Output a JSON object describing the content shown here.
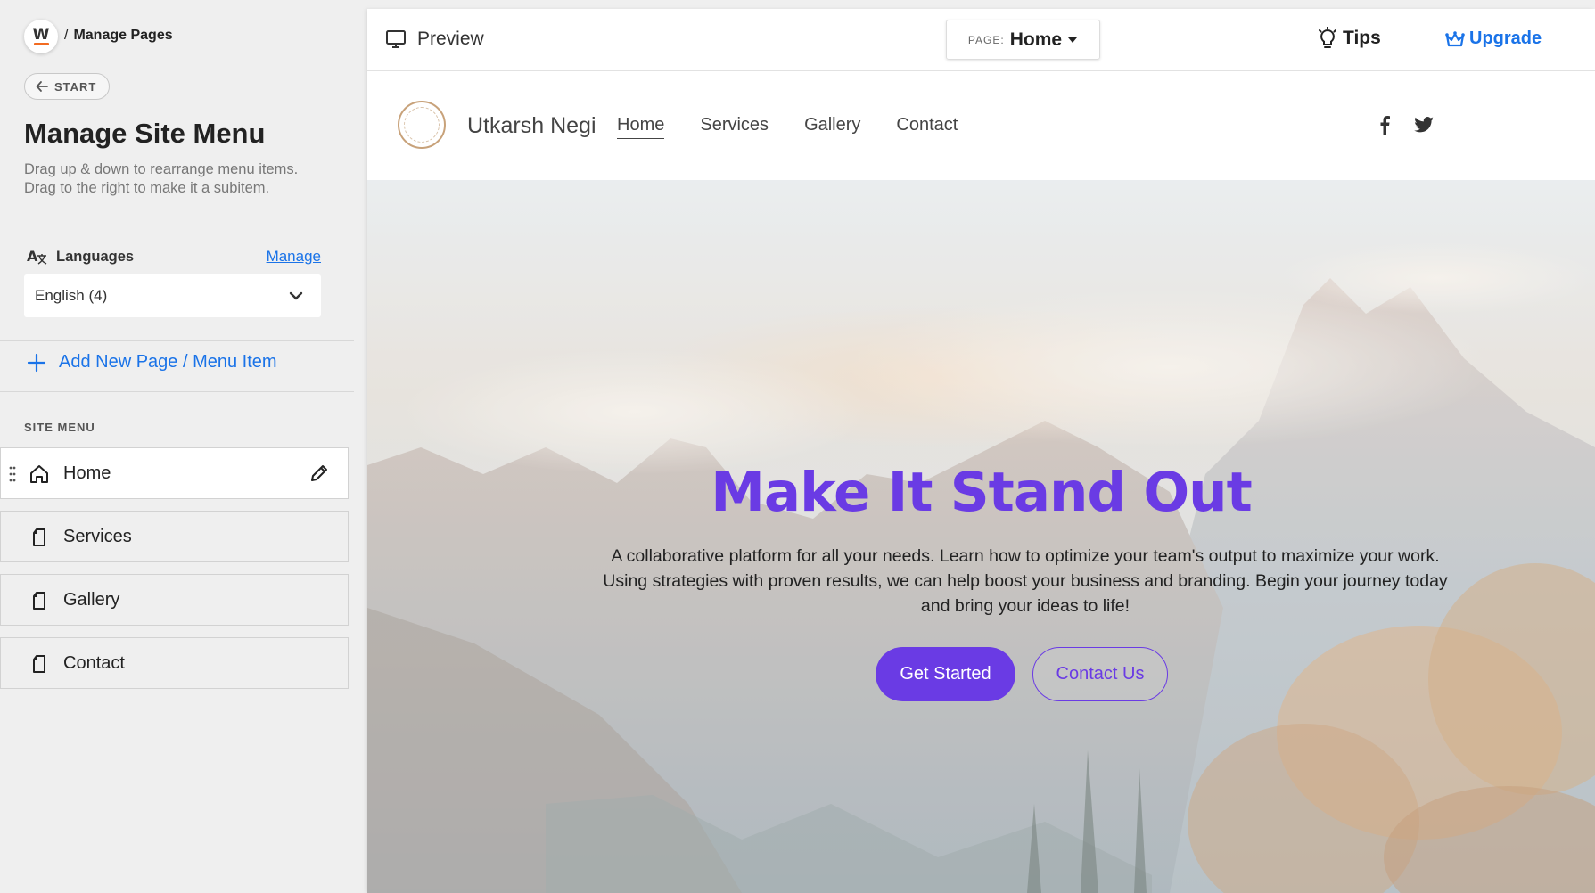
{
  "sidebar": {
    "logo_letter": "W",
    "breadcrumb_separator": "/",
    "breadcrumb": "Manage Pages",
    "start_label": "START",
    "title": "Manage Site Menu",
    "description": "Drag up & down to rearrange menu items. Drag to the right to make it a subitem.",
    "languages_label": "Languages",
    "languages_manage": "Manage",
    "language_selected": "English (4)",
    "add_page_label": "Add New Page / Menu Item",
    "site_menu_label": "SITE MENU",
    "menu_items": [
      {
        "label": "Home",
        "icon": "home-icon",
        "active": true
      },
      {
        "label": "Services",
        "icon": "page-icon",
        "active": false
      },
      {
        "label": "Gallery",
        "icon": "page-icon",
        "active": false
      },
      {
        "label": "Contact",
        "icon": "page-icon",
        "active": false
      }
    ]
  },
  "topbar": {
    "preview_label": "Preview",
    "page_label": "PAGE:",
    "page_value": "Home",
    "tips_label": "Tips",
    "upgrade_label": "Upgrade"
  },
  "site": {
    "name": "Utkarsh Negi",
    "nav": [
      "Home",
      "Services",
      "Gallery",
      "Contact"
    ],
    "active_nav": "Home",
    "social_icons": [
      "facebook-icon",
      "twitter-icon"
    ],
    "hero": {
      "title": "Make It Stand Out",
      "text": "A collaborative platform for all your needs. Learn how to optimize your team's output to maximize your work. Using strategies with proven results, we can help boost your business and branding. Begin your journey today and bring your ideas to life!",
      "primary_button": "Get Started",
      "secondary_button": "Contact Us"
    }
  },
  "colors": {
    "accent_blue": "#1a73e8",
    "brand_purple": "#6a3be4",
    "sidebar_bg": "#efefef",
    "logo_orange": "#f26b21"
  }
}
